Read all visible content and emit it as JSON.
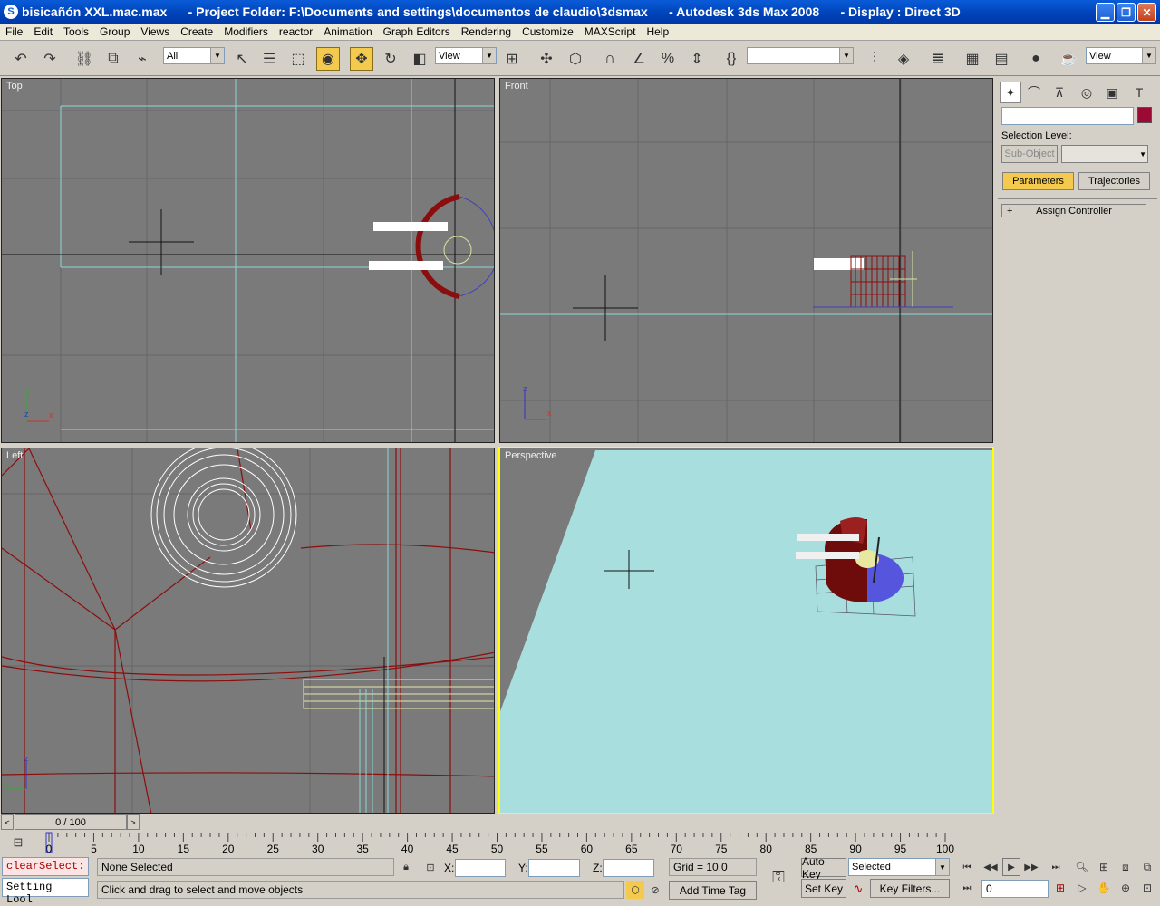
{
  "window": {
    "title": "bisicañón XXL.mac.max      - Project Folder: F:\\Documents and settings\\documentos de claudio\\3dsmax      - Autodesk 3ds Max 2008      - Display : Direct 3D",
    "buttons": [
      "minimize",
      "maximize",
      "close"
    ]
  },
  "menu": [
    "File",
    "Edit",
    "Tools",
    "Group",
    "Views",
    "Create",
    "Modifiers",
    "reactor",
    "Animation",
    "Graph Editors",
    "Rendering",
    "Customize",
    "MAXScript",
    "Help"
  ],
  "toolbar": {
    "selection_filter": "All",
    "ref_coord": "View",
    "named_selection": "",
    "render_view": "View"
  },
  "viewports": {
    "top": "Top",
    "front": "Front",
    "left": "Left",
    "perspective": "Perspective"
  },
  "colors": {
    "viewport_bg": "#7a7a7a",
    "grid": "#5e5e5e",
    "active_border": "#ffff00",
    "perspective_ground": "#a8dede",
    "object_red": "#8b0e0e",
    "object_white": "#ffffff",
    "object_color_swatch": "#9b0a34",
    "highlight_tab": "#f3c94e"
  },
  "command_panel": {
    "name_value": "",
    "selection_level_label": "Selection Level:",
    "sub_object_label": "Sub-Object",
    "tabs": [
      "Parameters",
      "Trajectories"
    ],
    "rollout": "Assign Controller",
    "rollout_sign": "+"
  },
  "time": {
    "slider_label": "0 / 100",
    "ticks": [
      "0",
      "5",
      "10",
      "15",
      "20",
      "25",
      "30",
      "35",
      "40",
      "45",
      "50",
      "55",
      "60",
      "65",
      "70",
      "75",
      "80",
      "85",
      "90",
      "95",
      "100"
    ],
    "current_frame": "0"
  },
  "status": {
    "maxscript_line1": "clearSelect:",
    "maxscript_line2": "Setting Lool",
    "selection": "None Selected",
    "prompt": "Click and drag to select and move objects",
    "x_label": "X:",
    "y_label": "Y:",
    "z_label": "Z:",
    "x_value": "",
    "y_value": "",
    "z_value": "",
    "grid": "Grid = 10,0",
    "add_time_tag": "Add Time Tag",
    "auto_key": "Auto Key",
    "set_key": "Set Key",
    "key_mode": "Selected",
    "key_filters": "Key Filters..."
  }
}
